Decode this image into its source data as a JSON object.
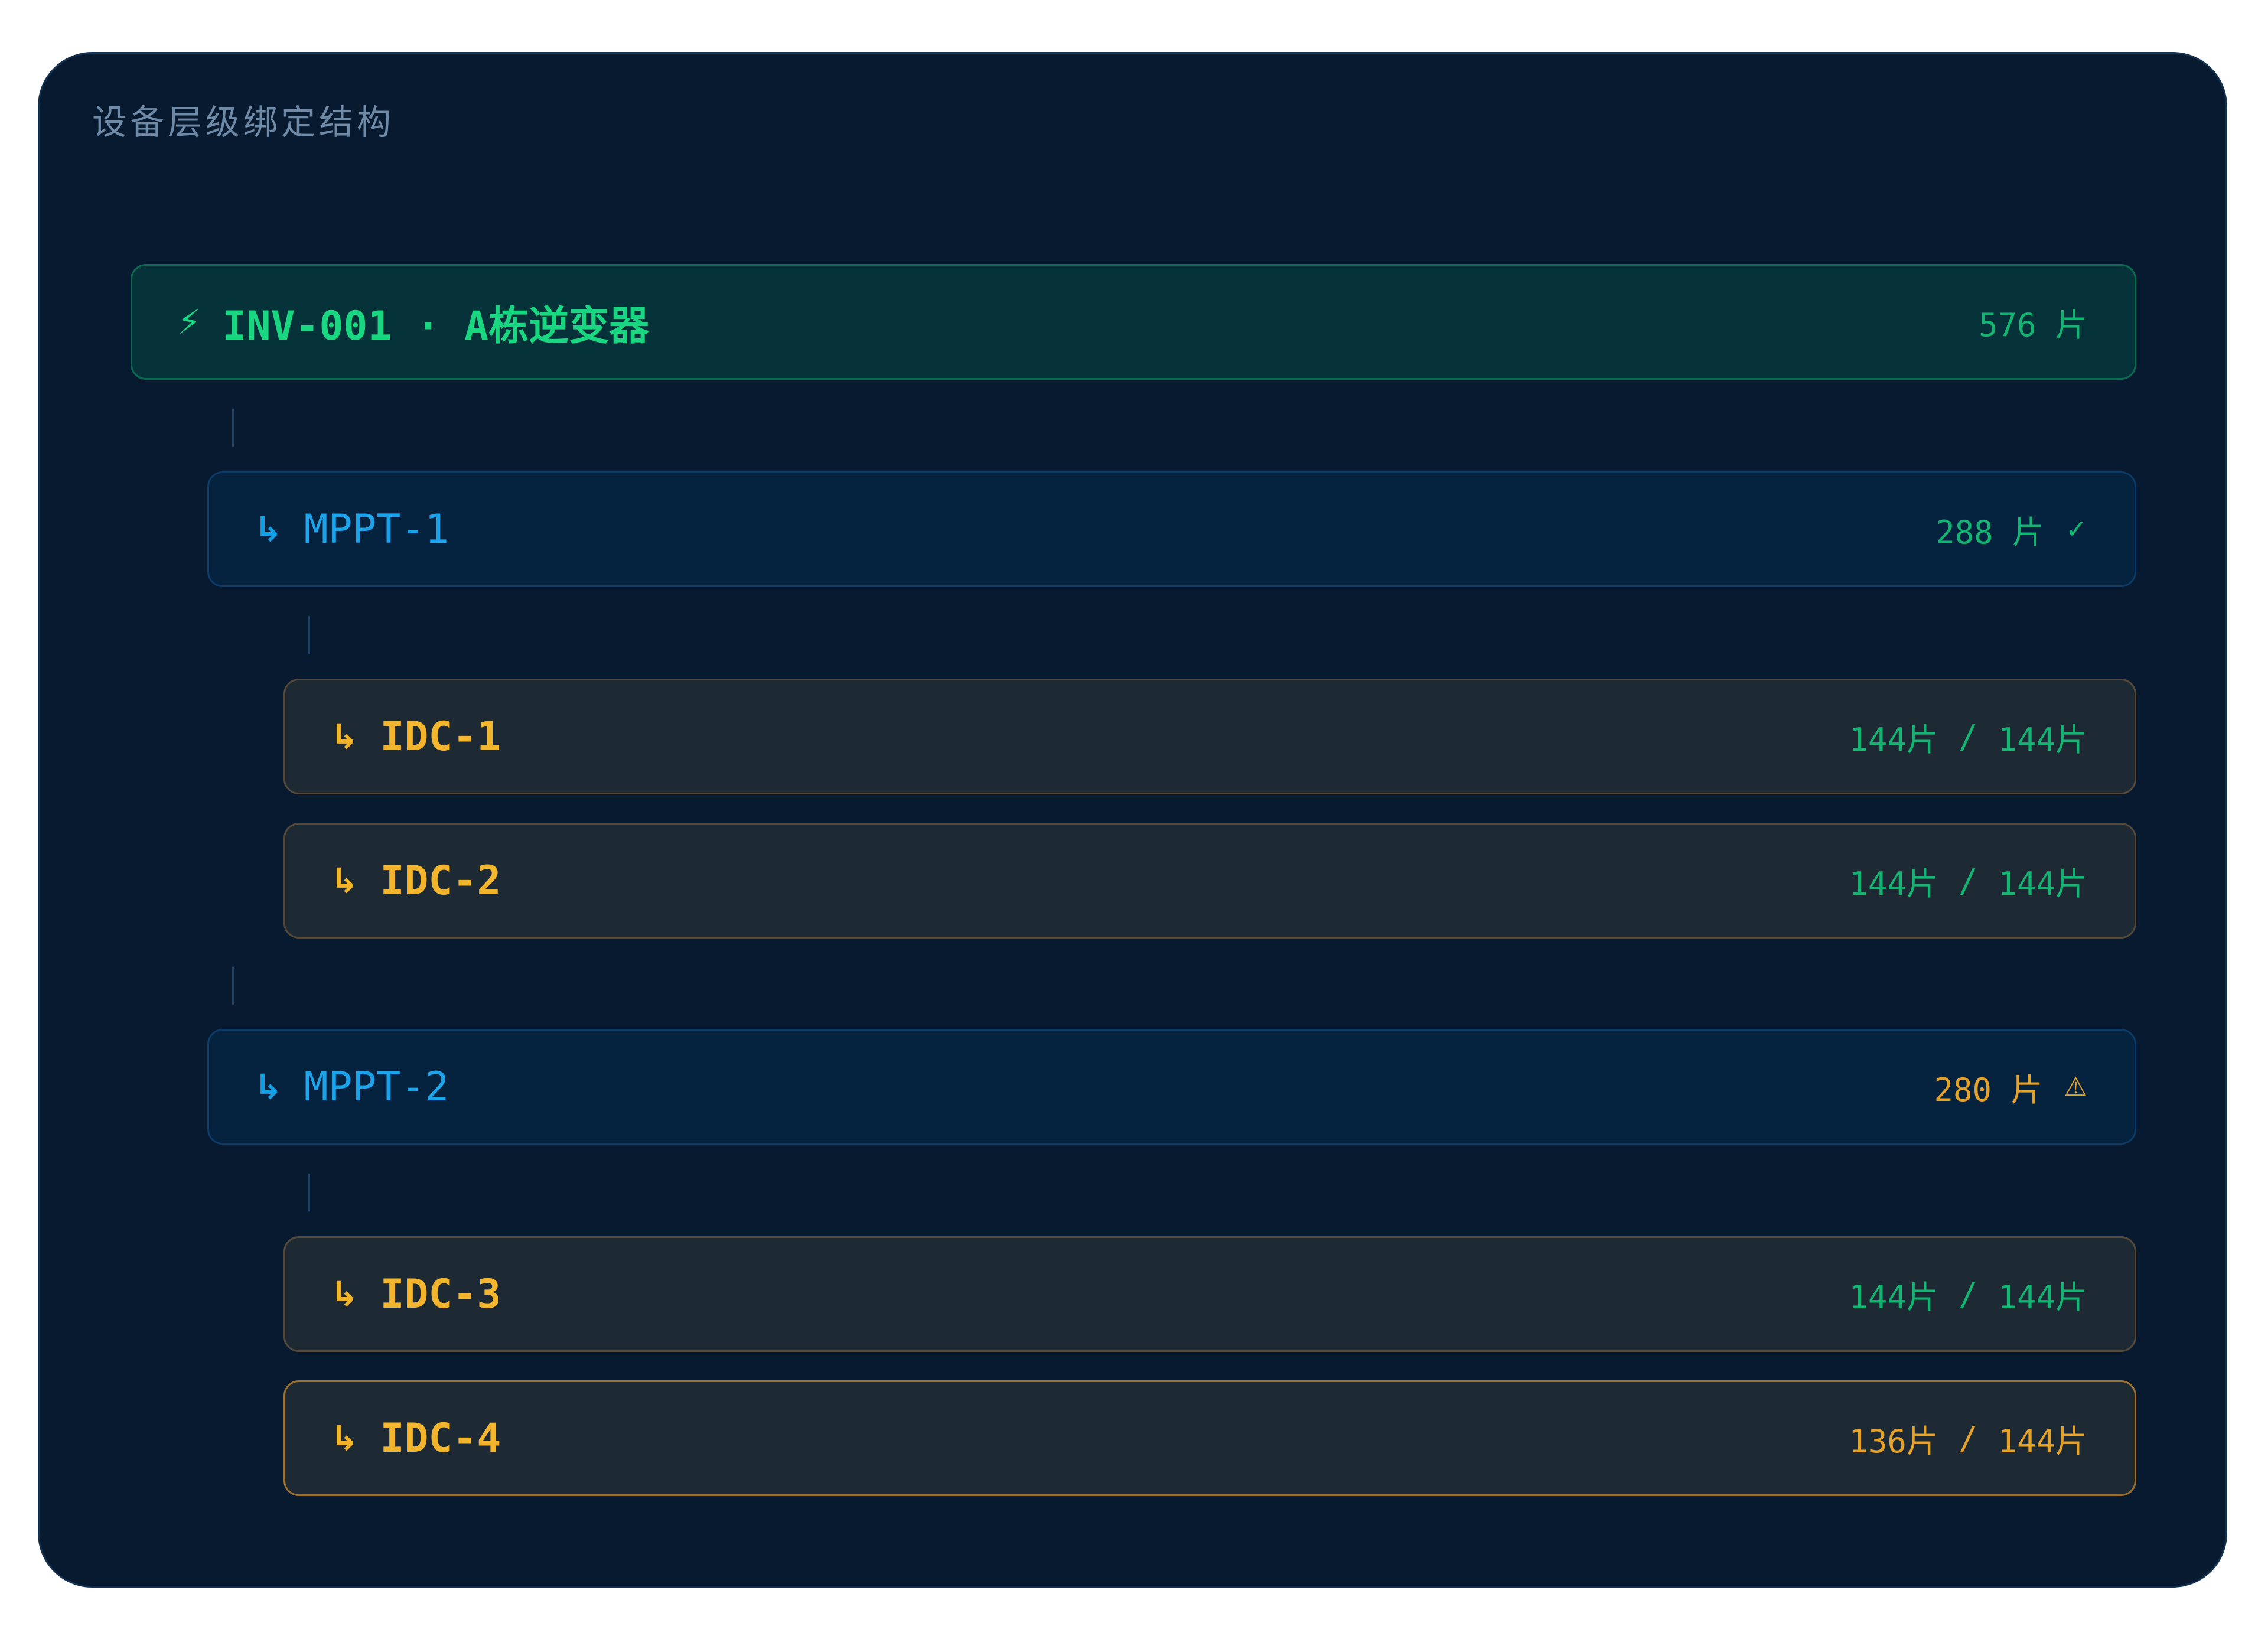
{
  "section_title": "设备层级绑定结构",
  "inverter": {
    "icon": "lightning-bolt-icon",
    "icon_glyph": "⚡",
    "label": "INV-001 · A栋逆变器",
    "panel_count": "576 片"
  },
  "mppts": [
    {
      "icon": "child-arrow-icon",
      "icon_glyph": "↳",
      "label": "MPPT-1",
      "panel_count": "288 片",
      "status_icon": "check-icon",
      "status_glyph": "✓"
    },
    {
      "icon": "child-arrow-icon",
      "icon_glyph": "↳",
      "label": "MPPT-2",
      "panel_count": "280 片",
      "status_icon": "warning-icon",
      "status_glyph": "⚠"
    }
  ],
  "idcs": [
    {
      "icon_glyph": "↳",
      "label": "IDC-1",
      "bound": "144片",
      "separator": "/",
      "capacity": "144片"
    },
    {
      "icon_glyph": "↳",
      "label": "IDC-2",
      "bound": "144片",
      "separator": "/",
      "capacity": "144片"
    },
    {
      "icon_glyph": "↳",
      "label": "IDC-3",
      "bound": "144片",
      "separator": "/",
      "capacity": "144片"
    },
    {
      "icon_glyph": "↳",
      "label": "IDC-4",
      "bound": "136片",
      "separator": "/",
      "capacity": "144片"
    }
  ],
  "colors": {
    "panel_bg": "#081a2f",
    "inverter_accent": "#19d680",
    "mppt_accent": "#1da3ea",
    "idc_accent": "#f3b52d",
    "ok_green": "#14b573",
    "warn_amber": "#e4a22a"
  }
}
